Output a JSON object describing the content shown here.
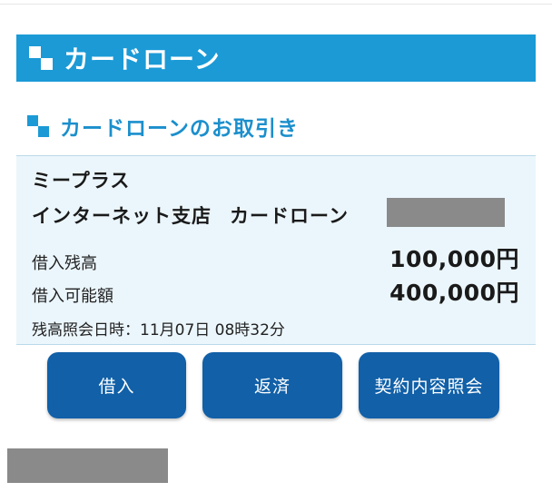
{
  "header": {
    "title": "カードローン"
  },
  "section": {
    "title": "カードローンのお取引き"
  },
  "account": {
    "bank_name": "ミープラス",
    "branch": "インターネット支店",
    "account_type": "カードローン",
    "balance_label": "借入残高",
    "balance_value": "100,000円",
    "available_label": "借入可能額",
    "available_value": "400,000円",
    "inquiry_label": "残高照会日時：",
    "inquiry_datetime": "11月07日 08時32分"
  },
  "buttons": {
    "borrow": "借入",
    "repay": "返済",
    "contract": "契約内容照会"
  },
  "icons": {
    "header_icon": "squares-icon",
    "section_icon": "squares-icon"
  },
  "colors": {
    "header_bg": "#1b9ad6",
    "section_title": "#1b8fcc",
    "panel_bg": "#ebf6fc",
    "button_bg": "#1160a8"
  }
}
